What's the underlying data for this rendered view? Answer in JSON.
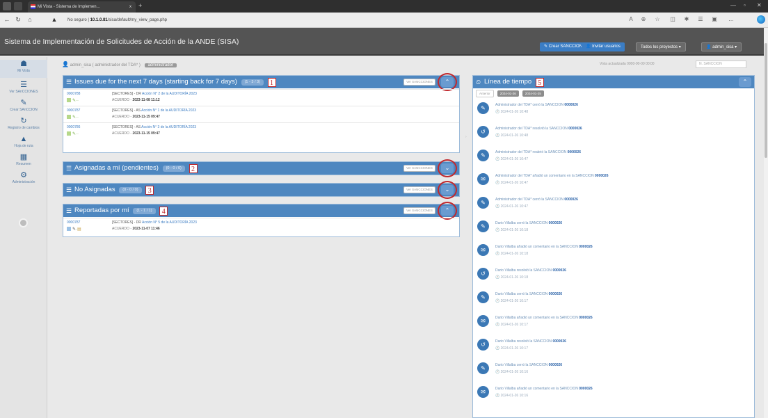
{
  "browser": {
    "tab_title": "Mi Vista - Sistema de Implemen...",
    "tab_close": "x",
    "new_tab": "+",
    "url_secure": "No seguro",
    "url_host": "10.1.0.81",
    "url_path": "/sisa/default/my_view_page.php"
  },
  "app": {
    "title": "Sistema de Implementación de Solicitudes de Acción de la ANDE (SISA)",
    "btn_new": "Crear SANCCION",
    "btn_invite": "Invitar usuarios",
    "btn_projects": "Todos los proyectos",
    "btn_user": "admin_sisa"
  },
  "sidebar": {
    "items": [
      {
        "icon": "☗",
        "label": "Mi Vista"
      },
      {
        "icon": "☰",
        "label": "Ver SAnCCIONES"
      },
      {
        "icon": "✎",
        "label": "Crear SAnCCION"
      },
      {
        "icon": "↻",
        "label": "Registro de cambios"
      },
      {
        "icon": "▲",
        "label": "Hoja de ruta"
      },
      {
        "icon": "▦",
        "label": "Resumen"
      },
      {
        "icon": "⚙",
        "label": "Administración"
      }
    ]
  },
  "crumb": {
    "user": "admin_sisa ( administrador del TDA* )",
    "tag": "administrador"
  },
  "right_info": "Vista actualizada 0000-00-00 00:00",
  "search_placeholder": "N. SANCCION",
  "panels": [
    {
      "title": "Issues due for the next 7 days (starting back for 7 days)",
      "count": "(1 - 3 / 3)",
      "num": "1",
      "button": "Ver SANCCIONES",
      "toggle": "⌃",
      "rows": [
        {
          "id": "0000788",
          "l1": "[SECTORES] - DR ",
          "link": "Acción N° 2 de la AUDITORÍA 2023",
          "l2a": "ACUERDO - ",
          "l2b": "2023-11-08 11:12"
        },
        {
          "id": "0000787",
          "l1": "[SECTORES] - AS ",
          "link": "Acción N° 1 de la AUDITORÍA 2023",
          "l2a": "ACUERDO - ",
          "l2b": "2023-11-15 09:47"
        },
        {
          "id": "0000786",
          "l1": "[SECTORES] - AS ",
          "link": "Acción N° 3 de la AUDITORÍA 2023",
          "l2a": "ACUERDO - ",
          "l2b": "2023-11-15 09:47"
        }
      ]
    },
    {
      "title": "Asignadas a mí (pendientes)",
      "count": "(0 - 0 / 0)",
      "num": "2",
      "button": "Ver SANCCIONES",
      "toggle": "⌄"
    },
    {
      "title": "No Asignadas",
      "count": "(0 - 0 / 0)",
      "num": "3",
      "button": "Ver SANCCIONES",
      "toggle": "⌄"
    },
    {
      "title": "Reportadas por mí",
      "count": "(1 - 1 / 1)",
      "num": "4",
      "button": "Ver SANCCIONES",
      "toggle": "⌃",
      "rows": [
        {
          "id": "0000787",
          "l1": "[SECTORES] - DR ",
          "link": "Acción N° 5 de la AUDITORÍA 2023",
          "l2a": "ACUERDO - ",
          "l2b": "2023-11-07 11:46"
        }
      ]
    }
  ],
  "timeline": {
    "title": "Línea de tiempo",
    "num": "5",
    "toggle": "⌃",
    "tabs": [
      "Anterior",
      "2024-01-26",
      "2024-01-25"
    ],
    "items": [
      {
        "icon": "✎",
        "text": "Administrador del TDA* cerró la SANCCION ",
        "ref": "0000026",
        "date": "2024-01-26 10:48"
      },
      {
        "icon": "↺",
        "text": "Administrador del TDA* resolvió la SANCCION ",
        "ref": "0000026",
        "date": "2024-01-26 10:48"
      },
      {
        "icon": "✎",
        "text": "Administrador del TDA* reabrió la SANCCION ",
        "ref": "0000026",
        "date": "2024-01-26 10:47"
      },
      {
        "icon": "✉",
        "text": "Administrador del TDA* añadió un comentario en la SANCCION ",
        "ref": "0000026",
        "date": "2024-01-26 10:47"
      },
      {
        "icon": "✎",
        "text": "Administrador del TDA* cerró la SANCCION ",
        "ref": "0000026",
        "date": "2024-01-26 10:47"
      },
      {
        "icon": "✎",
        "text": "Dario Villalba cerró la SANCCION ",
        "ref": "0000026",
        "date": "2024-01-26 10:18"
      },
      {
        "icon": "✉",
        "text": "Dario Villalba añadió un comentario en la SANCCION ",
        "ref": "0000026",
        "date": "2024-01-26 10:18"
      },
      {
        "icon": "↺",
        "text": "Dario Villalba resolvió la SANCCION ",
        "ref": "0000026",
        "date": "2024-01-26 10:18"
      },
      {
        "icon": "✎",
        "text": "Dario Villalba cerró la SANCCION ",
        "ref": "0000026",
        "date": "2024-01-26 10:17"
      },
      {
        "icon": "✉",
        "text": "Dario Villalba añadió un comentario en la SANCCION ",
        "ref": "0000026",
        "date": "2024-01-26 10:17"
      },
      {
        "icon": "↺",
        "text": "Dario Villalba resolvió la SANCCION ",
        "ref": "0000026",
        "date": "2024-01-26 10:17"
      },
      {
        "icon": "✎",
        "text": "Dario Villalba cerró la SANCCION ",
        "ref": "0000026",
        "date": "2024-01-26 10:16"
      },
      {
        "icon": "✉",
        "text": "Dario Villalba añadió un comentario en la SANCCION ",
        "ref": "0000026",
        "date": "2024-01-26 10:16"
      }
    ]
  },
  "colors": {
    "header_blue": "#4e87c0",
    "annotation_red": "#c0282d",
    "app_bar": "#545454"
  }
}
